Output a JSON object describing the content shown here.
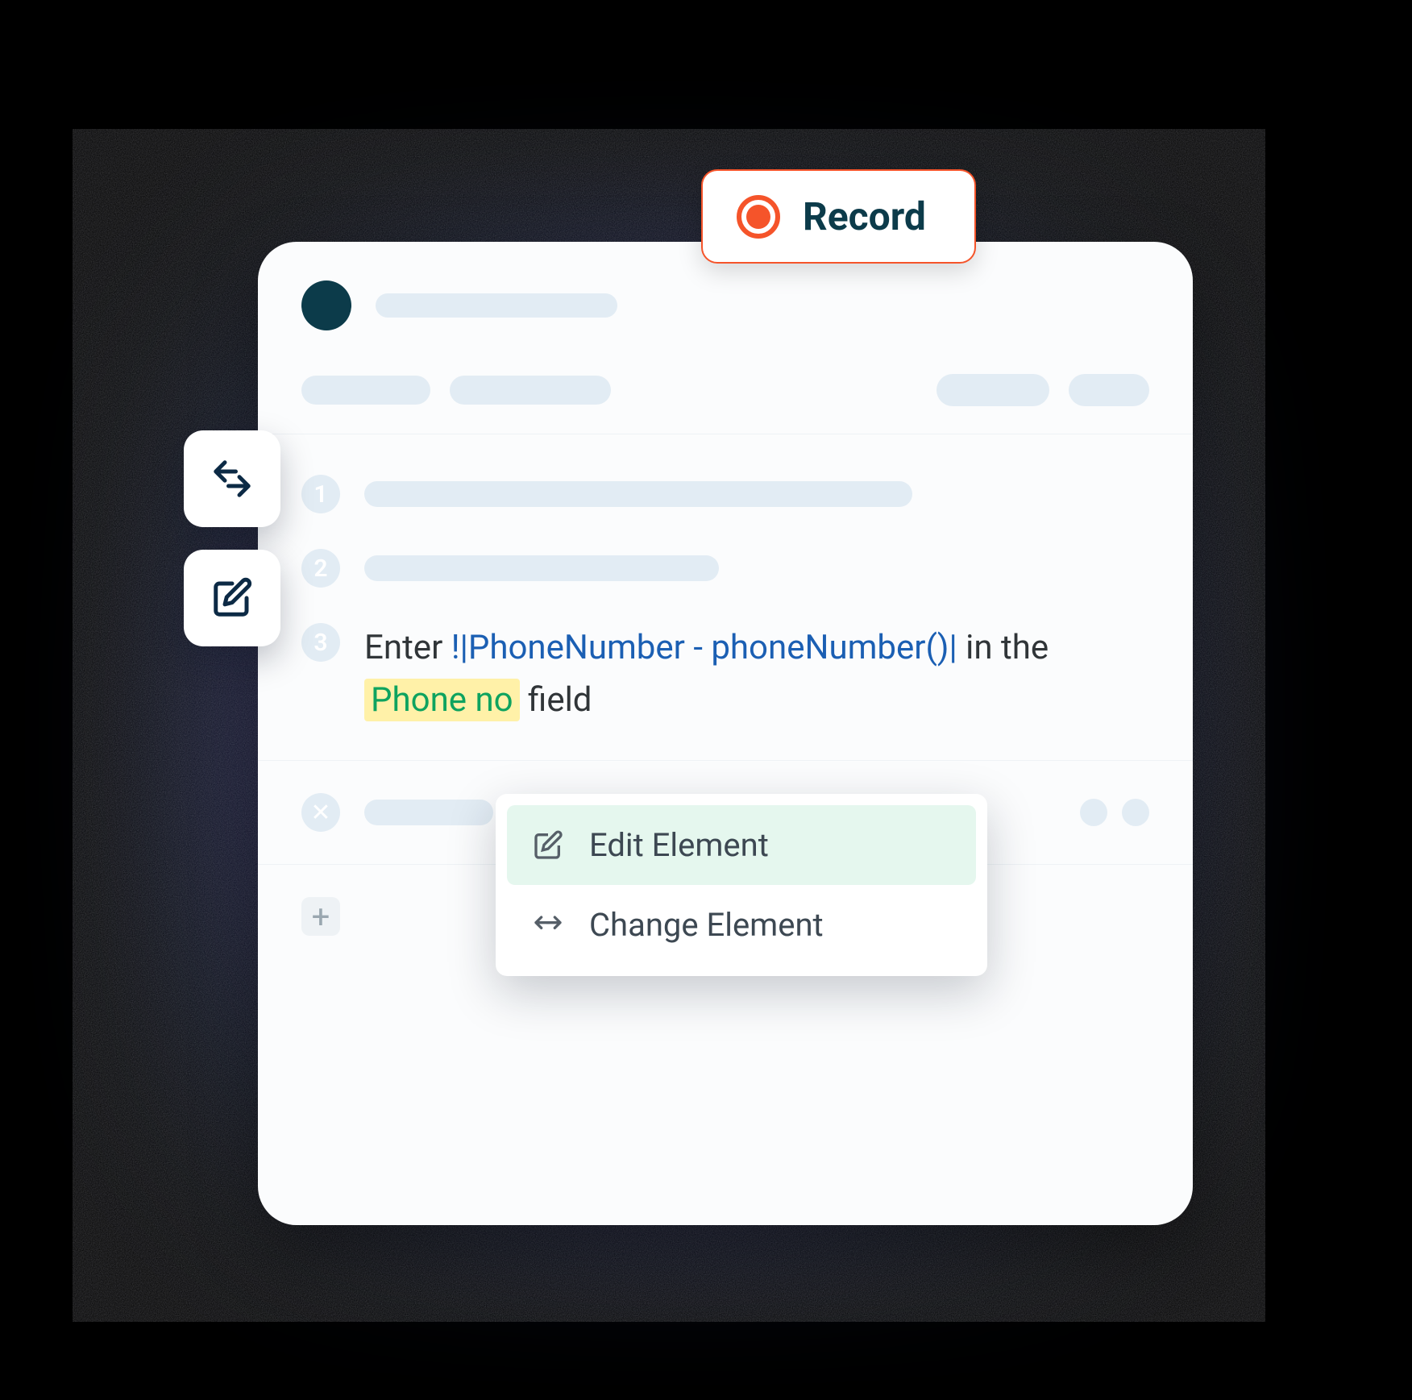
{
  "record": {
    "label": "Record"
  },
  "steps": {
    "num1": "1",
    "num2": "2",
    "num3": "3",
    "s3_prefix": "Enter ",
    "s3_var": "!|PhoneNumber - phoneNumber()|",
    "s3_mid": " in the ",
    "s3_el": "Phone no",
    "s3_suffix": " field"
  },
  "context_menu": {
    "edit": "Edit Element",
    "change": "Change Element"
  },
  "icons": {
    "close": "✕",
    "plus": "+"
  }
}
